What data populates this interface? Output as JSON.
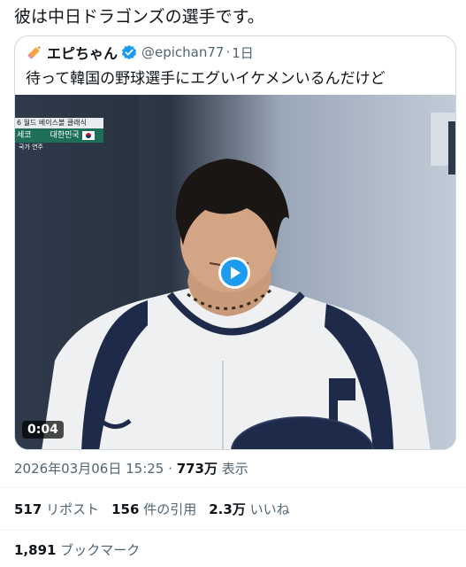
{
  "tweet": {
    "text": "彼は中日ドラゴンズの選手です。",
    "timestamp": "2026年03月06日 15:25",
    "separator": "·",
    "views_count": "773万",
    "views_label": "表示"
  },
  "quote": {
    "author_name": "エピちゃん",
    "handle": "@epichan77",
    "dot": "·",
    "time": "1日",
    "text": "待って韓国の野球選手にエグいイケメンいるんだけど",
    "video": {
      "duration": "0:04",
      "overlay_top": "6 월드 베이스볼 클래식",
      "overlay_mid_left": "세코",
      "overlay_mid_right": "대한민국",
      "overlay_bottom": "국가 연주"
    }
  },
  "stats": {
    "reposts_count": "517",
    "reposts_label": "リポスト",
    "quotes_count": "156",
    "quotes_label": "件の引用",
    "likes_count": "2.3万",
    "likes_label": "いいね",
    "bookmarks_count": "1,891",
    "bookmarks_label": "ブックマーク"
  },
  "colors": {
    "link": "#1d9bf0",
    "secondary_text": "#536471",
    "primary_text": "#0f1419"
  },
  "icons": {
    "author_emoji": "pencil-icon",
    "verified": "verified-badge-icon",
    "play": "play-icon"
  }
}
